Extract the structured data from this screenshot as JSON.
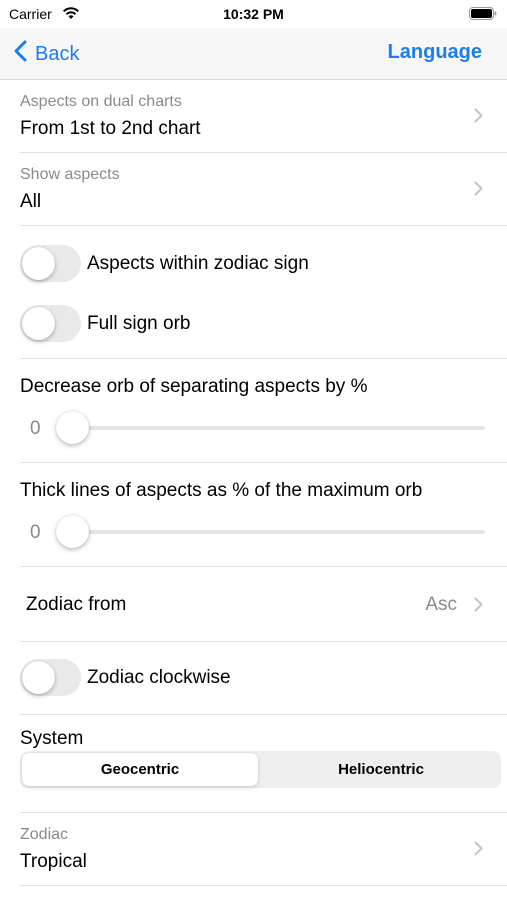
{
  "status_bar": {
    "carrier": "Carrier",
    "time": "10:32 PM"
  },
  "nav": {
    "back_label": "Back",
    "right_label": "Language"
  },
  "aspects_dual": {
    "caption": "Aspects on dual charts",
    "value": "From 1st to 2nd chart"
  },
  "show_aspects": {
    "caption": "Show aspects",
    "value": "All"
  },
  "toggles": {
    "within_sign": {
      "label": "Aspects within zodiac sign",
      "on": false
    },
    "full_sign_orb": {
      "label": "Full sign orb",
      "on": false
    },
    "zodiac_clockwise": {
      "label": "Zodiac clockwise",
      "on": false
    }
  },
  "sliders": {
    "decrease_orb": {
      "title": "Decrease orb of separating aspects by %",
      "value": "0",
      "level": 0
    },
    "thick_lines": {
      "title": "Thick lines of aspects as % of the maximum orb",
      "value": "0",
      "level": 0
    }
  },
  "zodiac_from": {
    "label": "Zodiac from",
    "value": "Asc"
  },
  "system": {
    "label": "System",
    "options": [
      "Geocentric",
      "Heliocentric"
    ],
    "selected": "Geocentric"
  },
  "zodiac": {
    "caption": "Zodiac",
    "value": "Tropical"
  },
  "colors": {
    "accent": "#1a7ef0",
    "secondary_text": "#8a8a8e",
    "switch_off": "#e9e9ea"
  },
  "icons": [
    "wifi-icon",
    "battery-icon",
    "chevron-left-icon",
    "chevron-right-icon"
  ]
}
